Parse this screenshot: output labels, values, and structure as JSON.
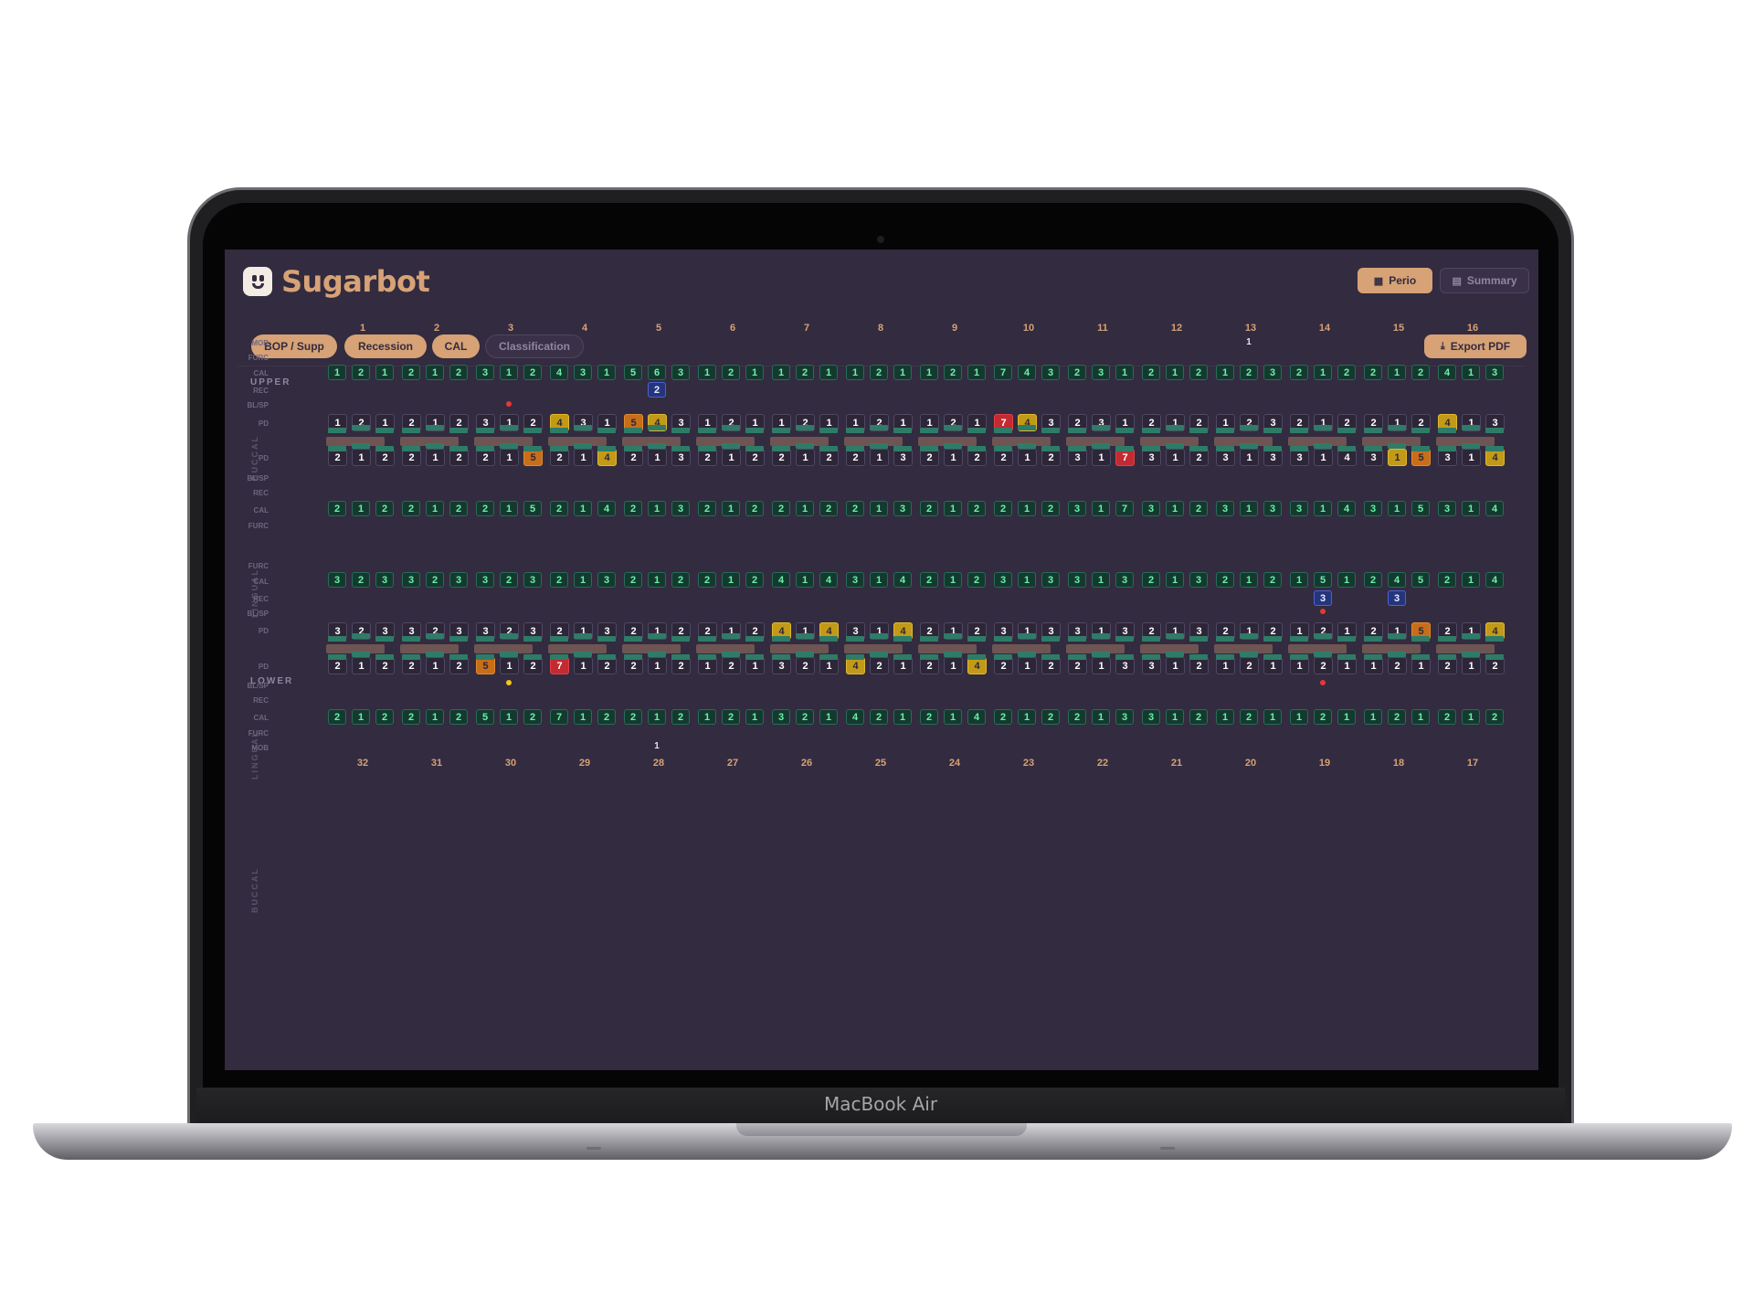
{
  "device_label": "MacBook Air",
  "app": {
    "name": "Sugarbot",
    "tabs": [
      {
        "label": "Perio",
        "icon": "grid-icon",
        "active": true
      },
      {
        "label": "Summary",
        "icon": "document-icon",
        "active": false
      }
    ],
    "filters": [
      {
        "label": "BOP / Supp",
        "active": true
      },
      {
        "label": "Recession",
        "active": true
      },
      {
        "label": "CAL",
        "active": true
      },
      {
        "label": "Classification",
        "active": false
      }
    ],
    "export_label": "Export PDF",
    "colors": {
      "background": "#332b3f",
      "accent": "#d6a276",
      "healthy": "#6cf0a9",
      "warning": "#c39a18",
      "moderate": "#c66e1a",
      "severe": "#c42a32",
      "recession": "#25357d",
      "bleeding": "#e53935",
      "suppuration": "#f5c518"
    }
  },
  "upper": {
    "label": "UPPER",
    "buccal_label": "BUCCAL",
    "lingual_label": "LINGUAL",
    "row_labels": {
      "mob": "MOB",
      "furc_b": "FURC",
      "cal_b": "CAL",
      "rec_b": "REC",
      "blsp_b": "BL/SP",
      "pd_b": "PD",
      "pd_l": "PD",
      "blsp_l": "BL/SP",
      "rec_l": "REC",
      "cal_l": "CAL",
      "furc_l": "FURC"
    },
    "teeth": [
      "1",
      "2",
      "3",
      "4",
      "5",
      "6",
      "7",
      "8",
      "9",
      "10",
      "11",
      "12",
      "13",
      "14",
      "15",
      "16"
    ],
    "buccal_cal": [
      "1",
      "2",
      "1",
      "2",
      "1",
      "2",
      "3",
      "1",
      "2",
      "4",
      "3",
      "1",
      "5",
      "6",
      "3",
      "1",
      "2",
      "1",
      "1",
      "2",
      "1",
      "1",
      "2",
      "1",
      "1",
      "2",
      "1",
      "7",
      "4",
      "3",
      "2",
      "3",
      "1",
      "2",
      "1",
      "2",
      "1",
      "2",
      "3",
      "2",
      "1",
      "2",
      "2",
      "1",
      "2",
      "4",
      "1",
      "3"
    ],
    "buccal_pd": [
      "1",
      "2",
      "1",
      "2",
      "1",
      "2",
      "3",
      "1",
      "2",
      "4",
      "3",
      "1",
      "5",
      "4",
      "3",
      "1",
      "2",
      "1",
      "1",
      "2",
      "1",
      "1",
      "2",
      "1",
      "1",
      "2",
      "1",
      "7",
      "4",
      "3",
      "2",
      "3",
      "1",
      "2",
      "1",
      "2",
      "1",
      "2",
      "3",
      "2",
      "1",
      "2",
      "2",
      "1",
      "2",
      "4",
      "1",
      "3"
    ],
    "lingual_pd": [
      "2",
      "1",
      "2",
      "2",
      "1",
      "2",
      "2",
      "1",
      "5",
      "2",
      "1",
      "4",
      "2",
      "1",
      "3",
      "2",
      "1",
      "2",
      "2",
      "1",
      "2",
      "2",
      "1",
      "3",
      "2",
      "1",
      "2",
      "2",
      "1",
      "2",
      "3",
      "1",
      "7",
      "3",
      "1",
      "2",
      "3",
      "1",
      "3",
      "3",
      "1",
      "4",
      "3",
      "1",
      "5",
      "3",
      "1",
      "4"
    ],
    "lingual_cal": [
      "2",
      "1",
      "2",
      "2",
      "1",
      "2",
      "2",
      "1",
      "5",
      "2",
      "1",
      "4",
      "2",
      "1",
      "3",
      "2",
      "1",
      "2",
      "2",
      "1",
      "2",
      "2",
      "1",
      "3",
      "2",
      "1",
      "2",
      "2",
      "1",
      "2",
      "3",
      "1",
      "7",
      "3",
      "1",
      "2",
      "3",
      "1",
      "3",
      "3",
      "1",
      "4",
      "3",
      "1",
      "5",
      "3",
      "1",
      "4"
    ],
    "recession": [
      {
        "site": 13,
        "value": "2"
      }
    ],
    "mobility": [
      {
        "tooth": 12,
        "value": "1"
      }
    ],
    "bleeding": [
      {
        "site": 7
      }
    ]
  },
  "lower": {
    "label": "LOWER",
    "buccal_label": "BUCCAL",
    "lingual_label": "LINGUAL",
    "row_labels": {
      "furc_l": "FURC",
      "cal_l": "CAL",
      "rec_l": "REC",
      "blsp_l": "BL/SP",
      "pd_l": "PD",
      "pd_b": "PD",
      "blsp_b": "BL/SP",
      "rec_b": "REC",
      "cal_b": "CAL",
      "furc_b": "FURC",
      "mob": "MOB"
    },
    "teeth": [
      "32",
      "31",
      "30",
      "29",
      "28",
      "27",
      "26",
      "25",
      "24",
      "23",
      "22",
      "21",
      "20",
      "19",
      "18",
      "17"
    ],
    "lingual_cal": [
      "3",
      "2",
      "3",
      "3",
      "2",
      "3",
      "3",
      "2",
      "3",
      "2",
      "1",
      "3",
      "2",
      "1",
      "2",
      "2",
      "1",
      "2",
      "4",
      "1",
      "4",
      "3",
      "1",
      "4",
      "2",
      "1",
      "2",
      "3",
      "1",
      "3",
      "3",
      "1",
      "3",
      "2",
      "1",
      "3",
      "2",
      "1",
      "2",
      "1",
      "5",
      "1",
      "2",
      "4",
      "5",
      "2",
      "1",
      "4"
    ],
    "lingual_pd": [
      "3",
      "2",
      "3",
      "3",
      "2",
      "3",
      "3",
      "2",
      "3",
      "2",
      "1",
      "3",
      "2",
      "1",
      "2",
      "2",
      "1",
      "2",
      "4",
      "1",
      "4",
      "3",
      "1",
      "4",
      "2",
      "1",
      "2",
      "3",
      "1",
      "3",
      "3",
      "1",
      "3",
      "2",
      "1",
      "3",
      "2",
      "1",
      "2",
      "1",
      "2",
      "1",
      "2",
      "1",
      "5",
      "2",
      "1",
      "4"
    ],
    "buccal_pd": [
      "2",
      "1",
      "2",
      "2",
      "1",
      "2",
      "5",
      "1",
      "2",
      "7",
      "1",
      "2",
      "2",
      "1",
      "2",
      "1",
      "2",
      "1",
      "3",
      "2",
      "1",
      "4",
      "2",
      "1",
      "2",
      "1",
      "4",
      "2",
      "1",
      "2",
      "2",
      "1",
      "3",
      "3",
      "1",
      "2",
      "1",
      "2",
      "1",
      "1",
      "2",
      "1",
      "1",
      "2",
      "1",
      "2",
      "1",
      "2"
    ],
    "buccal_cal": [
      "2",
      "1",
      "2",
      "2",
      "1",
      "2",
      "5",
      "1",
      "2",
      "7",
      "1",
      "2",
      "2",
      "1",
      "2",
      "1",
      "2",
      "1",
      "3",
      "2",
      "1",
      "4",
      "2",
      "1",
      "2",
      "1",
      "4",
      "2",
      "1",
      "2",
      "2",
      "1",
      "3",
      "3",
      "1",
      "2",
      "1",
      "2",
      "1",
      "1",
      "2",
      "1",
      "1",
      "2",
      "1",
      "2",
      "1",
      "2"
    ],
    "recession": [
      {
        "site": 40,
        "value": "3"
      },
      {
        "site": 43,
        "value": "3"
      }
    ],
    "mobility": [
      {
        "tooth": 4,
        "value": "1"
      }
    ],
    "bleeding": [
      {
        "site": 40,
        "side": "lingual"
      },
      {
        "site": 40,
        "side": "buccal"
      }
    ],
    "suppuration": [
      {
        "site": 7,
        "side": "buccal"
      }
    ]
  },
  "pd_flags": {
    "upper_buccal": {
      "9": "y",
      "12": "o",
      "13": "y",
      "27": "r",
      "28": "y",
      "45": "y"
    },
    "upper_lingual": {
      "8": "o",
      "11": "y",
      "32": "r",
      "43": "y",
      "44": "o",
      "47": "y"
    },
    "lower_lingual": {
      "18": "y",
      "20": "y",
      "23": "y",
      "44": "o",
      "47": "y"
    },
    "lower_buccal": {
      "6": "o",
      "9": "r",
      "21": "y",
      "26": "y"
    }
  }
}
